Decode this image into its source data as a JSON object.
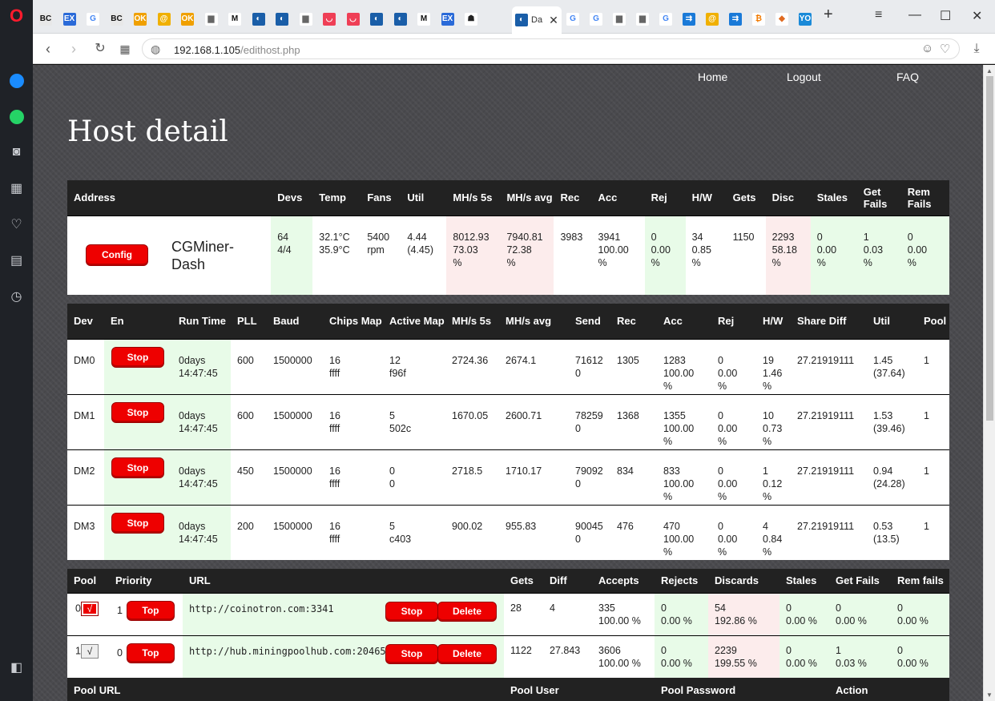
{
  "browser": {
    "active_tab_title": "Da",
    "url_host": "192.168.1.105",
    "url_path": "/edithost.php",
    "tabs": [
      {
        "icon": "bc-icon",
        "text": "BC",
        "bg": "#e8e8e8",
        "fg": "#111"
      },
      {
        "icon": "ex-icon",
        "text": "EX",
        "bg": "#2a6ad8",
        "fg": "#fff"
      },
      {
        "icon": "google-icon",
        "text": "G",
        "bg": "#fff",
        "fg": "#4285f4"
      },
      {
        "icon": "bc-icon",
        "text": "BC",
        "bg": "#e8e8e8",
        "fg": "#111"
      },
      {
        "icon": "ok-icon",
        "text": "OK",
        "bg": "#f0a000",
        "fg": "#fff"
      },
      {
        "icon": "at-icon",
        "text": "@",
        "bg": "#f0b000",
        "fg": "#fff"
      },
      {
        "icon": "ok-icon",
        "text": "OK",
        "bg": "#f0a000",
        "fg": "#fff"
      },
      {
        "icon": "document-icon",
        "text": "▆",
        "bg": "#fff",
        "fg": "#666"
      },
      {
        "icon": "medium-icon",
        "text": "M",
        "bg": "#fff",
        "fg": "#111"
      },
      {
        "icon": "tab-circle-icon",
        "text": "◐",
        "bg": "#1a5ea8",
        "fg": "#fff"
      },
      {
        "icon": "tab-circle-icon",
        "text": "◐",
        "bg": "#1a5ea8",
        "fg": "#fff"
      },
      {
        "icon": "document-icon",
        "text": "▆",
        "bg": "#fff",
        "fg": "#666"
      },
      {
        "icon": "pocket-icon",
        "text": "◡",
        "bg": "#ef3f56",
        "fg": "#fff"
      },
      {
        "icon": "pocket-icon",
        "text": "◡",
        "bg": "#ef3f56",
        "fg": "#fff"
      },
      {
        "icon": "tab-circle-icon",
        "text": "◐",
        "bg": "#1a5ea8",
        "fg": "#fff"
      },
      {
        "icon": "tab-circle-icon",
        "text": "◐",
        "bg": "#1a5ea8",
        "fg": "#fff"
      },
      {
        "icon": "medium-icon",
        "text": "M",
        "bg": "#fff",
        "fg": "#111"
      },
      {
        "icon": "ex-icon",
        "text": "EX",
        "bg": "#2a6ad8",
        "fg": "#fff"
      },
      {
        "icon": "ninja-icon",
        "text": "☗",
        "bg": "#fff",
        "fg": "#222"
      }
    ],
    "tabs_after": [
      {
        "icon": "google-icon",
        "text": "G",
        "bg": "#fff",
        "fg": "#4285f4"
      },
      {
        "icon": "google-icon",
        "text": "G",
        "bg": "#fff",
        "fg": "#4285f4"
      },
      {
        "icon": "document-icon",
        "text": "▆",
        "bg": "#fff",
        "fg": "#666"
      },
      {
        "icon": "document-icon",
        "text": "▆",
        "bg": "#fff",
        "fg": "#666"
      },
      {
        "icon": "google-icon",
        "text": "G",
        "bg": "#fff",
        "fg": "#4285f4"
      },
      {
        "icon": "dash-icon",
        "text": "⇉",
        "bg": "#1a7ad8",
        "fg": "#fff"
      },
      {
        "icon": "at-icon",
        "text": "@",
        "bg": "#f0b000",
        "fg": "#fff"
      },
      {
        "icon": "dash-icon",
        "text": "⇉",
        "bg": "#1a7ad8",
        "fg": "#fff"
      },
      {
        "icon": "coin-icon",
        "text": "₿",
        "bg": "#fff",
        "fg": "#f27a00"
      },
      {
        "icon": "diamond-icon",
        "text": "◆",
        "bg": "#fff",
        "fg": "#e06a20"
      },
      {
        "icon": "yo-icon",
        "text": "YO",
        "bg": "#1a8ad8",
        "fg": "#fff"
      }
    ]
  },
  "nav": {
    "home": "Home",
    "logout": "Logout",
    "faq": "FAQ"
  },
  "page_title": "Host detail",
  "host": {
    "headers": [
      "Address",
      "Devs",
      "Temp",
      "Fans",
      "Util",
      "MH/s 5s",
      "MH/s avg",
      "Rec",
      "Acc",
      "Rej",
      "H/W",
      "Gets",
      "Disc",
      "Stales",
      "Get Fails",
      "Rem Fails"
    ],
    "config_label": "Config",
    "name": "CGMiner-Dash",
    "cells": [
      {
        "l1": "64",
        "l2": "4/4",
        "l3": "",
        "bg": "g"
      },
      {
        "l1": "32.1°C",
        "l2": "35.9°C",
        "l3": "",
        "bg": ""
      },
      {
        "l1": "5400",
        "l2": "rpm",
        "l3": "",
        "bg": ""
      },
      {
        "l1": "4.44",
        "l2": "(4.45)",
        "l3": "",
        "bg": ""
      },
      {
        "l1": "8012.93",
        "l2": "73.03",
        "l3": "%",
        "bg": "r"
      },
      {
        "l1": "7940.81",
        "l2": "72.38",
        "l3": "%",
        "bg": "r"
      },
      {
        "l1": "3983",
        "l2": "",
        "l3": "",
        "bg": ""
      },
      {
        "l1": "3941",
        "l2": "100.00",
        "l3": "%",
        "bg": ""
      },
      {
        "l1": "0",
        "l2": "0.00",
        "l3": "%",
        "bg": "g"
      },
      {
        "l1": "34",
        "l2": "0.85",
        "l3": "%",
        "bg": ""
      },
      {
        "l1": "1150",
        "l2": "",
        "l3": "",
        "bg": ""
      },
      {
        "l1": "2293",
        "l2": "58.18",
        "l3": "%",
        "bg": "r"
      },
      {
        "l1": "0",
        "l2": "0.00",
        "l3": "%",
        "bg": "g"
      },
      {
        "l1": "1",
        "l2": "0.03",
        "l3": "%",
        "bg": "g"
      },
      {
        "l1": "0",
        "l2": "0.00",
        "l3": "%",
        "bg": "g"
      }
    ]
  },
  "devices": {
    "headers": [
      "Dev",
      "En",
      "Run Time",
      "PLL",
      "Baud",
      "Chips Map",
      "Active Map",
      "MH/s 5s",
      "MH/s avg",
      "Send",
      "Rec",
      "Acc",
      "Rej",
      "H/W",
      "Share Diff",
      "Util",
      "Pool"
    ],
    "stop_label": "Stop",
    "rows": [
      {
        "dev": "DM0",
        "rt1": "0days",
        "rt2": "14:47:45",
        "pll": "600",
        "baud": "1500000",
        "cm1": "16",
        "cm2": "ffff",
        "am1": "12",
        "am2": "f96f",
        "mh5": "2724.36",
        "mhavg": "2674.1",
        "send1": "71612",
        "send2": "0",
        "rec": "1305",
        "acc1": "1283",
        "acc2": "100.00",
        "acc3": "%",
        "rej1": "0",
        "rej2": "0.00",
        "rej3": "%",
        "hw1": "19",
        "hw2": "1.46",
        "hw3": "%",
        "diff": "27.21919111",
        "util1": "1.45",
        "util2": "(37.64)",
        "pool": "1"
      },
      {
        "dev": "DM1",
        "rt1": "0days",
        "rt2": "14:47:45",
        "pll": "600",
        "baud": "1500000",
        "cm1": "16",
        "cm2": "ffff",
        "am1": "5",
        "am2": "502c",
        "mh5": "1670.05",
        "mhavg": "2600.71",
        "send1": "78259",
        "send2": "0",
        "rec": "1368",
        "acc1": "1355",
        "acc2": "100.00",
        "acc3": "%",
        "rej1": "0",
        "rej2": "0.00",
        "rej3": "%",
        "hw1": "10",
        "hw2": "0.73",
        "hw3": "%",
        "diff": "27.21919111",
        "util1": "1.53",
        "util2": "(39.46)",
        "pool": "1"
      },
      {
        "dev": "DM2",
        "rt1": "0days",
        "rt2": "14:47:45",
        "pll": "450",
        "baud": "1500000",
        "cm1": "16",
        "cm2": "ffff",
        "am1": "0",
        "am2": "0",
        "mh5": "2718.5",
        "mhavg": "1710.17",
        "send1": "79092",
        "send2": "0",
        "rec": "834",
        "acc1": "833",
        "acc2": "100.00",
        "acc3": "%",
        "rej1": "0",
        "rej2": "0.00",
        "rej3": "%",
        "hw1": "1",
        "hw2": "0.12",
        "hw3": "%",
        "diff": "27.21919111",
        "util1": "0.94",
        "util2": "(24.28)",
        "pool": "1"
      },
      {
        "dev": "DM3",
        "rt1": "0days",
        "rt2": "14:47:45",
        "pll": "200",
        "baud": "1500000",
        "cm1": "16",
        "cm2": "ffff",
        "am1": "5",
        "am2": "c403",
        "mh5": "900.02",
        "mhavg": "955.83",
        "send1": "90045",
        "send2": "0",
        "rec": "476",
        "acc1": "470",
        "acc2": "100.00",
        "acc3": "%",
        "rej1": "0",
        "rej2": "0.00",
        "rej3": "%",
        "hw1": "4",
        "hw2": "0.84",
        "hw3": "%",
        "diff": "27.21919111",
        "util1": "0.53",
        "util2": "(13.5)",
        "pool": "1"
      }
    ]
  },
  "pools": {
    "headers": [
      "Pool",
      "Priority",
      "URL",
      "Gets",
      "Diff",
      "Accepts",
      "Rejects",
      "Discards",
      "Stales",
      "Get Fails",
      "Rem fails"
    ],
    "top_label": "Top",
    "stop_label": "Stop",
    "delete_label": "Delete",
    "rows": [
      {
        "num": "0",
        "checked": "√",
        "priority": "1",
        "url": "http://coinotron.com:3341",
        "gets": "28",
        "diff": "4",
        "acc1": "335",
        "acc2": "100.00 %",
        "rej1": "0",
        "rej2": "0.00 %",
        "disc1": "54",
        "disc2": "192.86 %",
        "st1": "0",
        "st2": "0.00 %",
        "gf1": "0",
        "gf2": "0.00 %",
        "rf1": "0",
        "rf2": "0.00 %"
      },
      {
        "num": "1",
        "checked": "√",
        "priority": "0",
        "url": "http://hub.miningpoolhub.com:20465",
        "gets": "1122",
        "diff": "27.843",
        "acc1": "3606",
        "acc2": "100.00 %",
        "rej1": "0",
        "rej2": "0.00 %",
        "disc1": "2239",
        "disc2": "199.55 %",
        "st1": "0",
        "st2": "0.00 %",
        "gf1": "1",
        "gf2": "0.03 %",
        "rf1": "0",
        "rf2": "0.00 %"
      }
    ],
    "footer_headers": [
      "Pool URL",
      "Pool User",
      "Pool Password",
      "Action"
    ]
  }
}
